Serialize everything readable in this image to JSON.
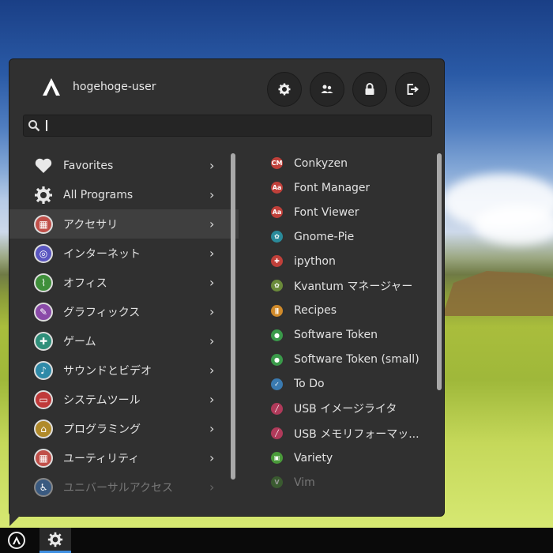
{
  "user": {
    "name": "hogehoge-user"
  },
  "header_buttons": [
    {
      "icon": "gear-icon"
    },
    {
      "icon": "users-icon"
    },
    {
      "icon": "lock-icon"
    },
    {
      "icon": "logout-icon"
    }
  ],
  "search": {
    "value": "",
    "placeholder": ""
  },
  "categories": [
    {
      "label": "Favorites",
      "icon": "heart-icon",
      "color": "#e8e8e8"
    },
    {
      "label": "All Programs",
      "icon": "gear-icon",
      "color": "#e8e8e8"
    },
    {
      "label": "アクセサリ",
      "icon": "accessories-icon",
      "color": "#c0504a"
    },
    {
      "label": "インターネット",
      "icon": "internet-icon",
      "color": "#5a56c0"
    },
    {
      "label": "オフィス",
      "icon": "office-icon",
      "color": "#3f8f3a"
    },
    {
      "label": "グラフィックス",
      "icon": "graphics-icon",
      "color": "#8a4aa8"
    },
    {
      "label": "ゲーム",
      "icon": "game-icon",
      "color": "#2f8f7a"
    },
    {
      "label": "サウンドとビデオ",
      "icon": "multimedia-icon",
      "color": "#2f8aa8"
    },
    {
      "label": "システムツール",
      "icon": "system-icon",
      "color": "#c03a3a"
    },
    {
      "label": "プログラミング",
      "icon": "programming-icon",
      "color": "#b08a2a"
    },
    {
      "label": "ユーティリティ",
      "icon": "utilities-icon",
      "color": "#c0504a"
    },
    {
      "label": "ユニバーサルアクセス",
      "icon": "accessibility-icon",
      "color": "#3a6aa8"
    }
  ],
  "apps": [
    {
      "label": "Conkyzen",
      "icon": "conkyzen-icon",
      "color": "#c0403a"
    },
    {
      "label": "Font Manager",
      "icon": "font-manager-icon",
      "color": "#c0403a"
    },
    {
      "label": "Font Viewer",
      "icon": "font-viewer-icon",
      "color": "#c0403a"
    },
    {
      "label": "Gnome-Pie",
      "icon": "gnome-pie-icon",
      "color": "#2a8a9a"
    },
    {
      "label": "ipython",
      "icon": "ipython-icon",
      "color": "#c0403a"
    },
    {
      "label": "Kvantum マネージャー",
      "icon": "kvantum-icon",
      "color": "#6a8a3a"
    },
    {
      "label": "Recipes",
      "icon": "recipes-icon",
      "color": "#d08a2a"
    },
    {
      "label": "Software Token",
      "icon": "software-token-icon",
      "color": "#3a9a4a"
    },
    {
      "label": "Software Token (small)",
      "icon": "software-token-small-icon",
      "color": "#3a9a4a"
    },
    {
      "label": "To Do",
      "icon": "todo-icon",
      "color": "#3a7ab0"
    },
    {
      "label": "USB イメージライタ",
      "icon": "usb-image-writer-icon",
      "color": "#b03a5a"
    },
    {
      "label": "USB メモリフォーマッ...",
      "icon": "usb-formatter-icon",
      "color": "#b03a5a"
    },
    {
      "label": "Variety",
      "icon": "variety-icon",
      "color": "#4a9a3a"
    },
    {
      "label": "Vim",
      "icon": "vim-icon",
      "color": "#4a8a3a"
    }
  ]
}
